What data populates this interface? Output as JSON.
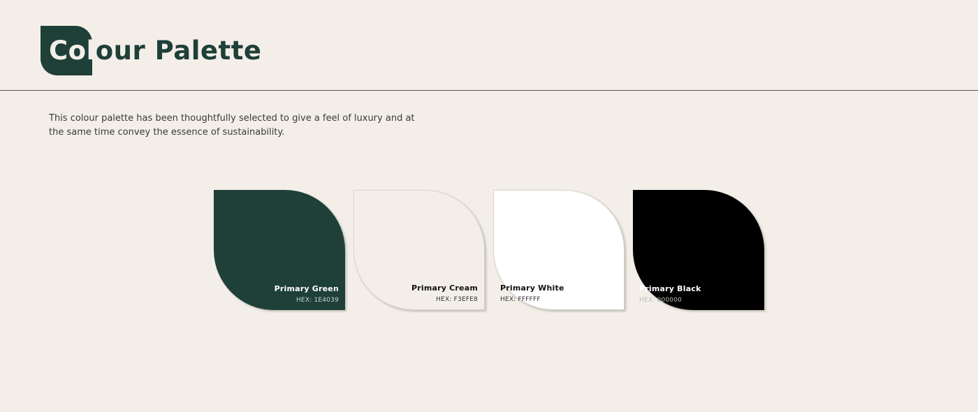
{
  "header": {
    "title_highlight": "Col",
    "title_rest": "our Palette",
    "badge_color": "#1E4039"
  },
  "intro": {
    "text": "This colour palette has been thoughtfully selected to give a feel of luxury and at the same time convey the essence of sustainability."
  },
  "swatches": [
    {
      "name": "Primary Green",
      "hex_label": "HEX: 1E4039",
      "color": "#1E4039",
      "text_color": "#FFFFFF",
      "hex_text_color": "#C9D3CF"
    },
    {
      "name": "Primary Cream",
      "hex_label": "HEX: F3EFE8",
      "color": "#F3EFE8",
      "text_color": "#111111",
      "hex_text_color": "#333333"
    },
    {
      "name": "Primary White",
      "hex_label": "HEX: FFFFFF",
      "color": "#FFFFFF",
      "text_color": "#111111",
      "hex_text_color": "#333333"
    },
    {
      "name": "Primary Black",
      "hex_label": "HEX: 000000",
      "color": "#000000",
      "text_color": "#FFFFFF",
      "hex_text_color": "#BBBBBB"
    }
  ]
}
